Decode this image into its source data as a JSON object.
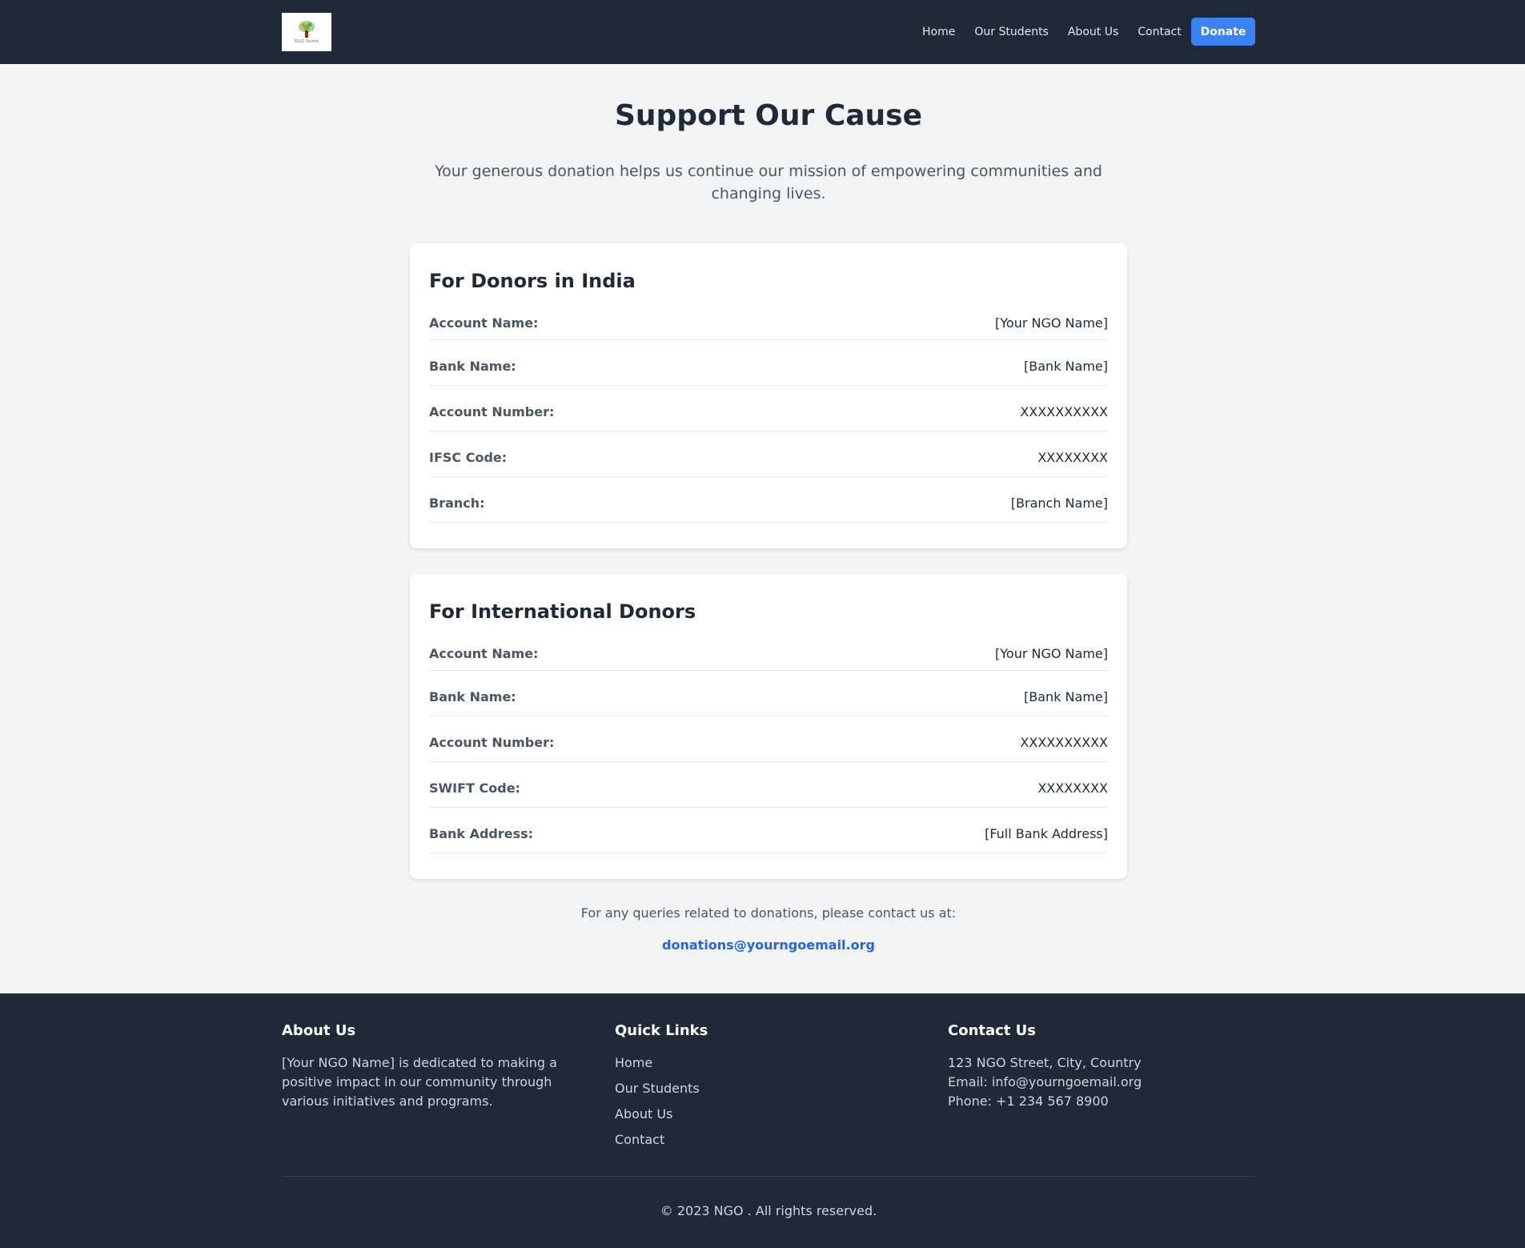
{
  "header": {
    "logo_text": "NGO Name",
    "nav": [
      "Home",
      "Our Students",
      "About Us",
      "Contact"
    ],
    "donate_label": "Donate"
  },
  "hero": {
    "title": "Support Our Cause",
    "subtitle": "Your generous donation helps us continue our mission of empowering communities and changing lives."
  },
  "india": {
    "title": "For Donors in India",
    "rows": [
      {
        "label": "Account Name:",
        "value": "[Your NGO Name]"
      },
      {
        "label": "Bank Name:",
        "value": "[Bank Name]"
      },
      {
        "label": "Account Number:",
        "value": "XXXXXXXXXX"
      },
      {
        "label": "IFSC Code:",
        "value": "XXXXXXXX"
      },
      {
        "label": "Branch:",
        "value": "[Branch Name]"
      }
    ]
  },
  "international": {
    "title": "For International Donors",
    "rows": [
      {
        "label": "Account Name:",
        "value": "[Your NGO Name]"
      },
      {
        "label": "Bank Name:",
        "value": "[Bank Name]"
      },
      {
        "label": "Account Number:",
        "value": "XXXXXXXXXX"
      },
      {
        "label": "SWIFT Code:",
        "value": "XXXXXXXX"
      },
      {
        "label": "Bank Address:",
        "value": "[Full Bank Address]"
      }
    ]
  },
  "query": {
    "text": "For any queries related to donations, please contact us at:",
    "email": "donations@yourngoemail.org"
  },
  "footer": {
    "about_title": "About Us",
    "about_text": "[Your NGO Name] is dedicated to making a positive impact in our community through various initiatives and programs.",
    "links_title": "Quick Links",
    "links": [
      "Home",
      "Our Students",
      "About Us",
      "Contact"
    ],
    "contact_title": "Contact Us",
    "address": "123 NGO Street, City, Country",
    "email": "Email: info@yourngoemail.org",
    "phone": "Phone: +1 234 567 8900",
    "copyright": "© 2023 NGO . All rights reserved."
  },
  "colors": {
    "header_bg": "#1f2937",
    "accent": "#3b82f6",
    "link": "#2563eb",
    "page_bg": "#f3f4f6"
  }
}
